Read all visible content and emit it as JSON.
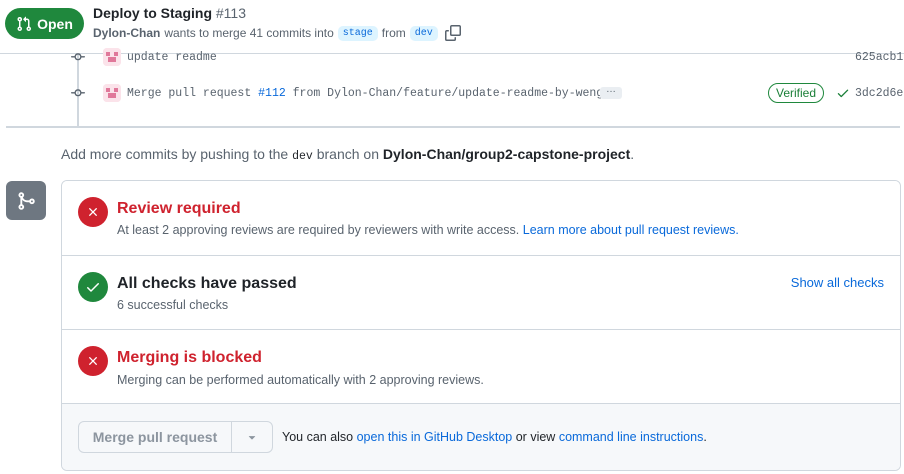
{
  "header": {
    "state_label": "Open",
    "title": "Deploy to Staging",
    "number": "#113",
    "author": "Dylon-Chan",
    "meta_text": "wants to merge 41 commits into",
    "base_branch": "stage",
    "from_text": "from",
    "head_branch": "dev"
  },
  "commits": [
    {
      "message": "update readme",
      "sha": "625acb1"
    },
    {
      "message_prefix": "Merge pull request",
      "pr_link": "#112",
      "message_suffix": "from Dylon-Chan/feature/update-readme-by-weng…",
      "ellipsis": "…",
      "verified": "Verified",
      "sha": "3dc2d6e"
    }
  ],
  "hint": {
    "prefix": "Add more commits by pushing to the",
    "branch": "dev",
    "middle": "branch on",
    "repo": "Dylon-Chan/group2-capstone-project",
    "suffix": "."
  },
  "merge_box": {
    "review": {
      "title": "Review required",
      "desc": "At least 2 approving reviews are required by reviewers with write access.",
      "link": "Learn more about pull request reviews."
    },
    "checks": {
      "title": "All checks have passed",
      "desc": "6 successful checks",
      "link": "Show all checks"
    },
    "blocked": {
      "title": "Merging is blocked",
      "desc": "Merging can be performed automatically with 2 approving reviews."
    },
    "footer": {
      "merge_button": "Merge pull request",
      "prefix": "You can also",
      "desktop_link": "open this in GitHub Desktop",
      "middle": "or view",
      "cli_link": "command line instructions",
      "suffix": "."
    }
  },
  "colors": {
    "open_green": "#1f883d",
    "danger_red": "#cf222e",
    "link_blue": "#0969da"
  }
}
